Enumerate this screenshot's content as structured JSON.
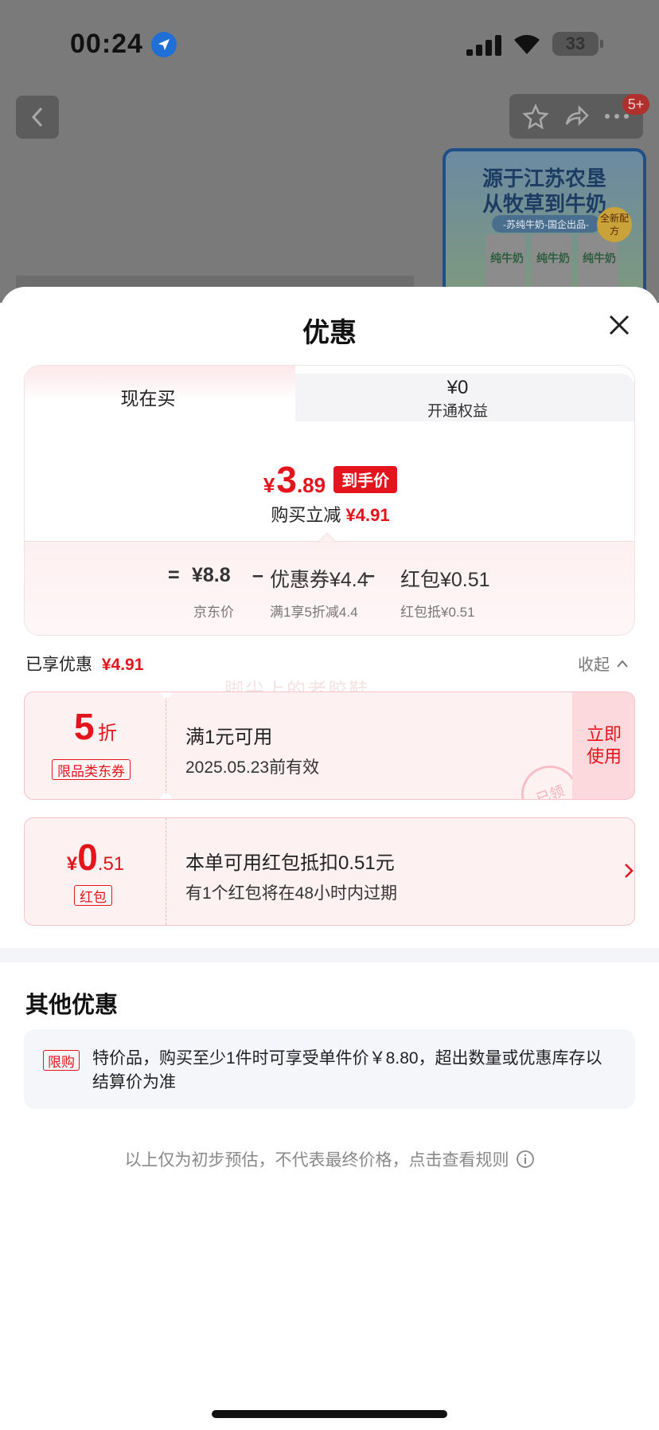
{
  "status_bar": {
    "time": "00:24",
    "battery": "33"
  },
  "nav": {
    "badge": "5+"
  },
  "product_image": {
    "line1": "源于江苏农垦",
    "line2": "从牧草到牛奶",
    "line3": "-苏纯牛奶-国企出品-",
    "carton_label": "纯牛奶",
    "new_formula": "全新配方"
  },
  "sheet": {
    "title": "优惠",
    "tabs": {
      "now": "现在买",
      "membership_value": "¥0",
      "membership_label": "开通权益"
    },
    "final_price": {
      "yen": "¥",
      "int": "3",
      "dec": ".89",
      "tag": "到手价"
    },
    "savings": {
      "label": "购买立减",
      "value": "¥4.91"
    },
    "formula": {
      "eq": "=",
      "jd_price": "¥8.8",
      "minus1": "–",
      "coupon": "优惠券¥4.4",
      "minus2": "–",
      "red_packet": "红包¥0.51",
      "jd_price_label": "京东价",
      "coupon_label": "满1享5折减4.4",
      "red_packet_label": "红包抵¥0.51"
    },
    "enjoyed": {
      "label": "已享优惠",
      "value": "¥4.91"
    },
    "collapse": "收起",
    "watermark": "脚尖上的老胶鞋",
    "coupons": [
      {
        "big_value": "5",
        "unit": "折",
        "badge": "限品类东券",
        "title": "满1元可用",
        "subtitle": "2025.05.23前有效",
        "action": "立即使用",
        "stamp": "已领"
      },
      {
        "yen": "¥",
        "big_value": "0",
        "decimal": ".51",
        "badge": "红包",
        "title": "本单可用红包抵扣0.51元",
        "subtitle": "有1个红包将在48小时内过期"
      }
    ],
    "other": {
      "title": "其他优惠",
      "tag": "限购",
      "text": "特价品，购买至少1件时可享受单件价￥8.80，超出数量或优惠库存以结算价为准"
    },
    "disclaimer": "以上仅为初步预估，不代表最终价格，点击查看规则"
  },
  "colors": {
    "accent": "#e3141b",
    "coupon_bg": "#fef1f2",
    "overlay": "#7a7a7a"
  }
}
